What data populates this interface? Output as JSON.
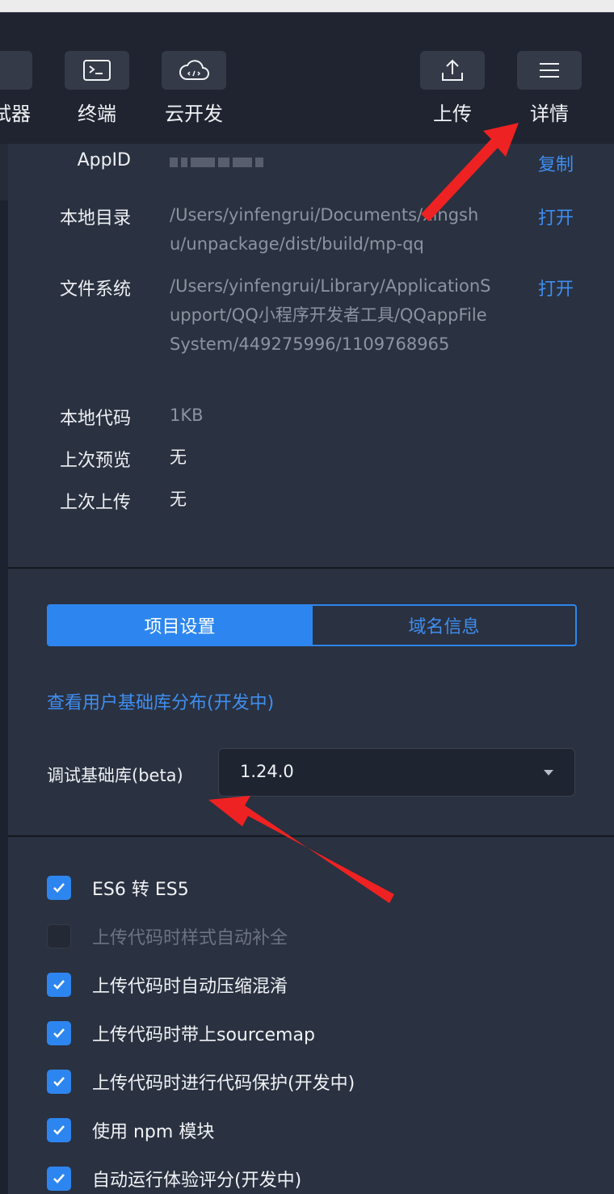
{
  "toolbar": {
    "items": [
      {
        "label": "试器",
        "icon": "debugger-icon"
      },
      {
        "label": "终端",
        "icon": "terminal-icon"
      },
      {
        "label": "云开发",
        "icon": "cloud-code-icon"
      },
      {
        "label": "上传",
        "icon": "upload-icon"
      },
      {
        "label": "详情",
        "icon": "menu-icon"
      }
    ]
  },
  "info": {
    "appid_label": "AppID",
    "copy_label": "复制",
    "local_dir_label": "本地目录",
    "local_dir_value": "/Users/yinfengrui/Documents/xingshu/unpackage/dist/build/mp-qq",
    "open_label": "打开",
    "fs_label": "文件系统",
    "fs_value": "/Users/yinfengrui/Library/ApplicationSupport/QQ小程序开发者工具/QQappFileSystem/449275996/1109768965",
    "code_size_label": "本地代码",
    "code_size_value": "1KB",
    "last_preview_label": "上次预览",
    "last_preview_value": "无",
    "last_upload_label": "上次上传",
    "last_upload_value": "无"
  },
  "settings": {
    "tab_project": "项目设置",
    "tab_domain": "域名信息",
    "lib_link": "查看用户基础库分布(开发中)",
    "debug_lib_label": "调试基础库(beta)",
    "debug_lib_value": "1.24.0"
  },
  "options": [
    {
      "label": "ES6 转 ES5",
      "checked": true
    },
    {
      "label": "上传代码时样式自动补全",
      "checked": false
    },
    {
      "label": "上传代码时自动压缩混淆",
      "checked": true
    },
    {
      "label": "上传代码时带上sourcemap",
      "checked": true
    },
    {
      "label": "上传代码时进行代码保护(开发中)",
      "checked": true
    },
    {
      "label": "使用 npm 模块",
      "checked": true
    },
    {
      "label": "自动运行体验评分(开发中)",
      "checked": true
    }
  ],
  "colors": {
    "accent": "#2d86ef",
    "annotation": "#ee2222"
  }
}
